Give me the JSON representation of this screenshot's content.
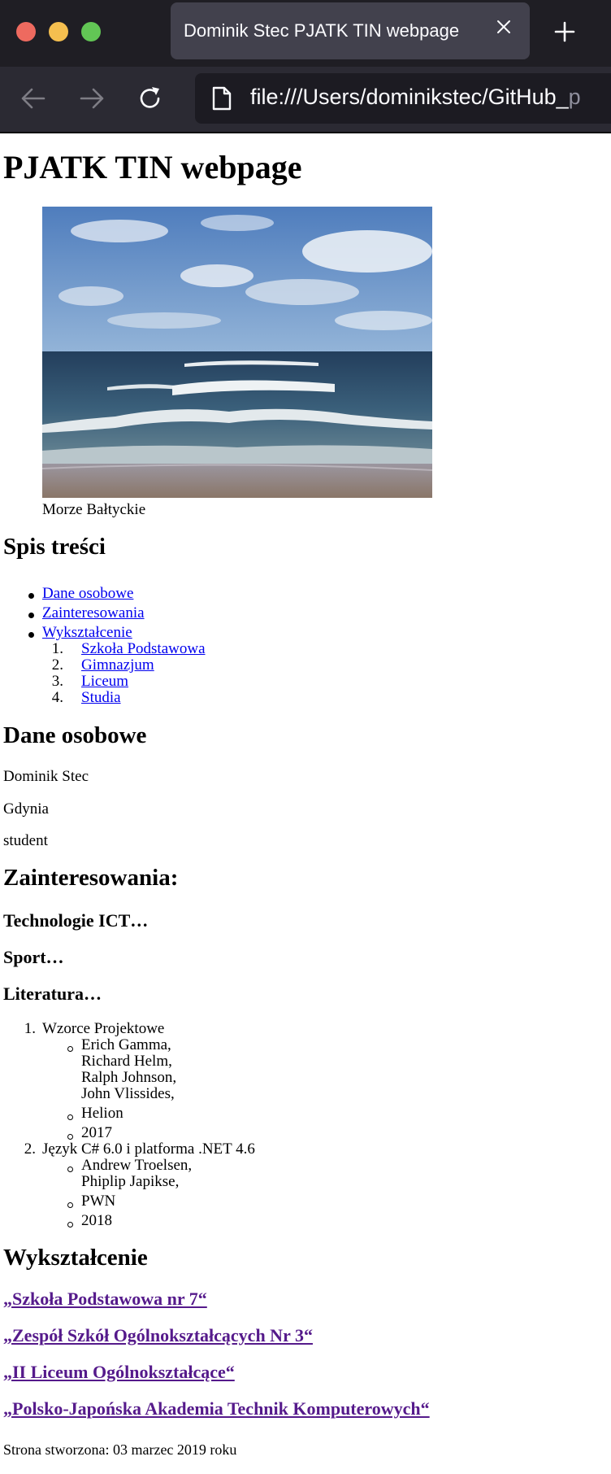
{
  "browser": {
    "tab_title": "Dominik Stec PJATK TIN webpage",
    "url_main": "file:///Users/dominikstec/GitHub_",
    "url_dim": "p"
  },
  "page": {
    "heading": "PJATK TIN webpage",
    "figure": {
      "caption": "Morze Bałtyckie"
    },
    "toc": {
      "heading": "Spis treści",
      "items": [
        "Dane osobowe",
        "Zainteresowania",
        "Wykształcenie"
      ],
      "sub_items": [
        "Szkoła Podstawowa",
        "Gimnazjum",
        "Liceum",
        "Studia"
      ]
    },
    "personal": {
      "heading": "Dane osobowe",
      "name": "Dominik Stec",
      "city": "Gdynia",
      "role": "student"
    },
    "interests": {
      "heading": "Zainteresowania:",
      "topics": [
        "Technologie ICT…",
        "Sport…",
        "Literatura…"
      ],
      "books": [
        {
          "title": "Wzorce Projektowe",
          "authors": [
            "Erich Gamma,",
            "Richard Helm,",
            "Ralph Johnson,",
            "John Vlissides,"
          ],
          "publisher": "Helion",
          "year": "2017"
        },
        {
          "title": "Język C# 6.0 i platforma .NET 4.6",
          "authors": [
            "Andrew Troelsen,",
            "Phiplip Japikse,"
          ],
          "publisher": "PWN",
          "year": "2018"
        }
      ]
    },
    "education": {
      "heading": "Wykształcenie",
      "schools": [
        "„Szkoła Podstawowa nr 7“",
        "„Zespół Szkół Ogólnokształcących Nr 3“",
        "„II Liceum Ogólnokształcące“",
        "„Polsko-Japońska Akademia Technik Komputerowych“"
      ]
    },
    "footer": "Strona stworzona: 03 marzec 2019 roku"
  }
}
